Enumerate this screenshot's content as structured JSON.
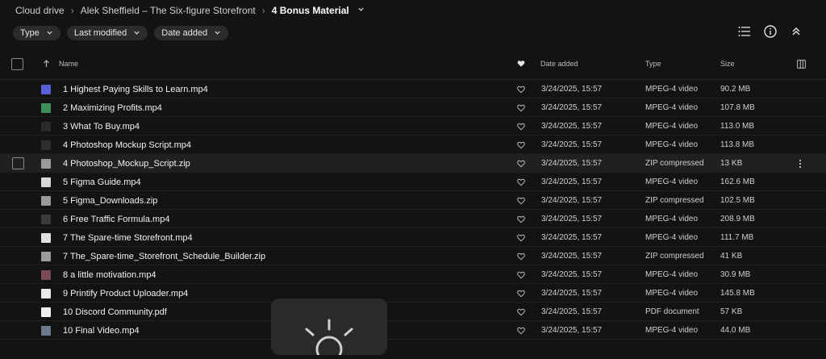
{
  "breadcrumb": {
    "root": "Cloud drive",
    "parent": "Alek Sheffield – The Six-figure Storefront",
    "current": "4 Bonus Material"
  },
  "filters": {
    "type": "Type",
    "last_modified": "Last modified",
    "date_added": "Date added"
  },
  "columns": {
    "name": "Name",
    "date_added": "Date added",
    "type": "Type",
    "size": "Size"
  },
  "files": [
    {
      "name": "1 Highest Paying Skills to Learn.mp4",
      "date": "3/24/2025, 15:57",
      "type": "MPEG-4 video",
      "size": "90.2 MB",
      "thumb": "#5a5fd9"
    },
    {
      "name": "2 Maximizing Profits.mp4",
      "date": "3/24/2025, 15:57",
      "type": "MPEG-4 video",
      "size": "107.8 MB",
      "thumb": "#3f8f5a"
    },
    {
      "name": "3 What To Buy.mp4",
      "date": "3/24/2025, 15:57",
      "type": "MPEG-4 video",
      "size": "113.0 MB",
      "thumb": "#2b2b2b"
    },
    {
      "name": "4 Photoshop Mockup Script.mp4",
      "date": "3/24/2025, 15:57",
      "type": "MPEG-4 video",
      "size": "113.8 MB",
      "thumb": "#2f2f2f"
    },
    {
      "name": "4 Photoshop_Mockup_Script.zip",
      "date": "3/24/2025, 15:57",
      "type": "ZIP compressed",
      "size": "13 KB",
      "thumb": "#9a9a9a"
    },
    {
      "name": "5 Figma Guide.mp4",
      "date": "3/24/2025, 15:57",
      "type": "MPEG-4 video",
      "size": "162.6 MB",
      "thumb": "#d8d8d8"
    },
    {
      "name": "5 Figma_Downloads.zip",
      "date": "3/24/2025, 15:57",
      "type": "ZIP compressed",
      "size": "102.5 MB",
      "thumb": "#9a9a9a"
    },
    {
      "name": "6 Free Traffic Formula.mp4",
      "date": "3/24/2025, 15:57",
      "type": "MPEG-4 video",
      "size": "208.9 MB",
      "thumb": "#3a3a3a"
    },
    {
      "name": "7 The Spare-time Storefront.mp4",
      "date": "3/24/2025, 15:57",
      "type": "MPEG-4 video",
      "size": "111.7 MB",
      "thumb": "#e0e0e0"
    },
    {
      "name": "7 The_Spare-time_Storefront_Schedule_Builder.zip",
      "date": "3/24/2025, 15:57",
      "type": "ZIP compressed",
      "size": "41 KB",
      "thumb": "#9a9a9a"
    },
    {
      "name": "8 a little motivation.mp4",
      "date": "3/24/2025, 15:57",
      "type": "MPEG-4 video",
      "size": "30.9 MB",
      "thumb": "#7a4a55"
    },
    {
      "name": "9 Printify Product Uploader.mp4",
      "date": "3/24/2025, 15:57",
      "type": "MPEG-4 video",
      "size": "145.8 MB",
      "thumb": "#e8e8e8"
    },
    {
      "name": "10 Discord Community.pdf",
      "date": "3/24/2025, 15:57",
      "type": "PDF document",
      "size": "57 KB",
      "thumb": "#eeeeee"
    },
    {
      "name": "10 Final Video.mp4",
      "date": "3/24/2025, 15:57",
      "type": "MPEG-4 video",
      "size": "44.0 MB",
      "thumb": "#6a7a8a"
    }
  ],
  "selected_index": 4
}
